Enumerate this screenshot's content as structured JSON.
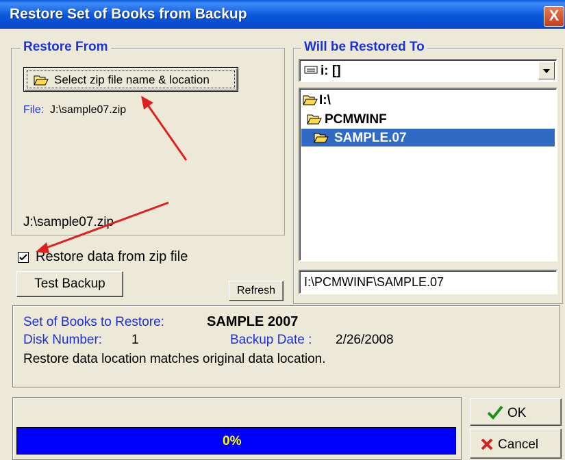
{
  "window": {
    "title": "Restore Set of Books from Backup",
    "close_glyph": "X"
  },
  "restore_from": {
    "legend": "Restore From",
    "select_button": "Select zip file name & location",
    "file_label": "File:",
    "file_value": "J:\\sample07.zip",
    "path_display": "J:\\sample07.zip"
  },
  "restored_to": {
    "legend": "Will be Restored To",
    "drive": "i: []",
    "folders": [
      {
        "label": "I:\\",
        "selected": false
      },
      {
        "label": "PCMWINF",
        "selected": false
      },
      {
        "label": "SAMPLE.07",
        "selected": true
      }
    ],
    "path": "I:\\PCMWINF\\SAMPLE.07"
  },
  "options": {
    "checkbox_label": "Restore data from zip file",
    "checked": true,
    "test_backup": "Test Backup",
    "refresh": "Refresh"
  },
  "info": {
    "set_label": "Set of Books to Restore:",
    "set_value": "SAMPLE 2007",
    "disk_label": "Disk Number:",
    "disk_value": "1",
    "date_label": "Backup Date :",
    "date_value": "2/26/2008",
    "message": "Restore data location matches original data location."
  },
  "progress": {
    "text": "0%",
    "value": 0
  },
  "buttons": {
    "ok": "OK",
    "cancel": "Cancel"
  },
  "colors": {
    "title_blue": "#0a56d9",
    "label_blue": "#1c30d8",
    "progress_blue": "#0000ff",
    "progress_text": "#ffff00",
    "selection": "#316ac5",
    "arrow_red": "#e02020"
  }
}
